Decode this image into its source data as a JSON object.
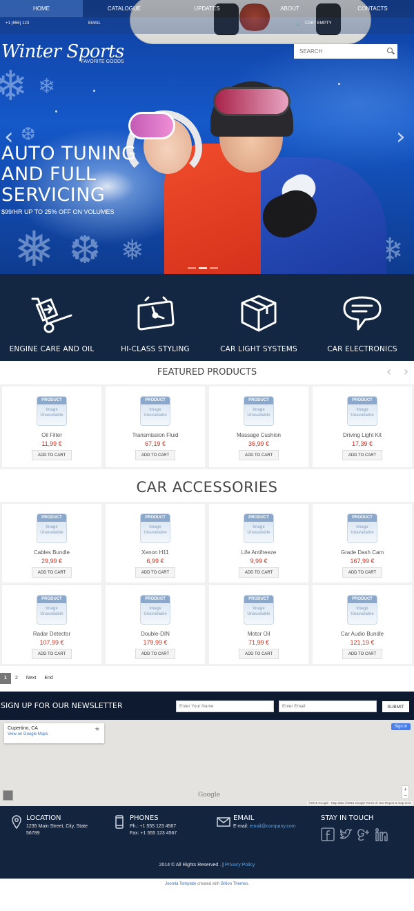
{
  "nav": {
    "items": [
      {
        "label": "HOME",
        "active": true
      },
      {
        "label": "CATALOGUE",
        "active": false
      },
      {
        "label": "UPDATES",
        "active": false
      },
      {
        "label": "ABOUT",
        "active": false
      },
      {
        "label": "CONTACTS",
        "active": false
      }
    ]
  },
  "infobar": {
    "phone": "+1 (555) 123",
    "email": "EMAIL",
    "cart": "CART EMPTY"
  },
  "brand": {
    "name": "Winter Sports",
    "tagline": "FAVORITE GOODS"
  },
  "search": {
    "placeholder": "SEARCH"
  },
  "hero": {
    "title_line1": "AUTO TUNING",
    "title_line2": "AND FULL",
    "title_line3": "SERVICING",
    "subtitle": "$99/HR UP TO 25% OFF ON VOLUMES",
    "prev": "‹",
    "next": "›"
  },
  "features": [
    {
      "label": "ENGINE CARE AND OIL",
      "icon": "hand-truck-icon"
    },
    {
      "label": "HI-CLASS STYLING",
      "icon": "clock-ticket-icon"
    },
    {
      "label": "CAR LIGHT SYSTEMS",
      "icon": "box-icon"
    },
    {
      "label": "CAR ELECTRONICS",
      "icon": "chat-bubble-icon"
    }
  ],
  "placeholder": {
    "bar": "PRODUCT",
    "line1": "Image",
    "line2": "Unavailable"
  },
  "featured": {
    "title": "FEATURED PRODUCTS",
    "prev": "‹",
    "next": "›",
    "products": [
      {
        "name": "Oil Filter",
        "price": "11,99 €",
        "button": "ADD TO CART"
      },
      {
        "name": "Transmission Fluid",
        "price": "67,19 €",
        "button": "ADD TO CART"
      },
      {
        "name": "Massage Cushion",
        "price": "36,99 €",
        "button": "ADD TO CART"
      },
      {
        "name": "Driving Light Kit",
        "price": "17,39 €",
        "button": "ADD TO CART"
      }
    ]
  },
  "accessories": {
    "title": "CAR ACCESSORIES",
    "rows": [
      [
        {
          "name": "Cables Bundle",
          "price": "29,99 €",
          "button": "ADD TO CART"
        },
        {
          "name": "Xenon H11",
          "price": "6,99 €",
          "button": "ADD TO CART"
        },
        {
          "name": "Life Antifreeze",
          "price": "9,99 €",
          "button": "ADD TO CART"
        },
        {
          "name": "Grade Dash Cam",
          "price": "167,99 €",
          "button": "ADD TO CART"
        }
      ],
      [
        {
          "name": "Radar Detector",
          "price": "107,99 €",
          "button": "ADD TO CART"
        },
        {
          "name": "Double-DIN",
          "price": "179,99 €",
          "button": "ADD TO CART"
        },
        {
          "name": "Motor Oil",
          "price": "71,99 €",
          "button": "ADD TO CART"
        },
        {
          "name": "Car Audio Bundle",
          "price": "121,19 €",
          "button": "ADD TO CART"
        }
      ]
    ]
  },
  "pager": {
    "current": "1",
    "page2": "2",
    "next": "Next",
    "end": "End"
  },
  "newsletter": {
    "title": "SIGN UP FOR OUR NEWSLETTER",
    "name_placeholder": "Enter Your Name",
    "email_placeholder": "Enter Email",
    "submit": "SUBMIT"
  },
  "map": {
    "place": "Cupertino, CA",
    "link": "View on Google Maps",
    "signin": "Sign in",
    "logo": "Google",
    "credits": "©2015 Google - Map data ©2015 Google   Terms of Use   Report a map error"
  },
  "footer": {
    "location": {
      "title": "LOCATION",
      "line1": "1235 Main Street, City, State",
      "line2": "56789"
    },
    "phones": {
      "title": "PHONES",
      "line1": "Ph.: +1 555 123 4567",
      "line2": "Fax: +1 555 123 4567"
    },
    "email": {
      "title": "EMAIL",
      "prefix": "E-mail: ",
      "address": "email@company.com"
    },
    "social": {
      "title": "STAY IN TOUCH"
    },
    "copyright": "2014 © All Rights Reserved . | ",
    "privacy": "Privacy Policy"
  },
  "credit": {
    "link1": "Joomla Template",
    "middle": " created with ",
    "link2": "Billion Themes",
    "end": "."
  },
  "colors": {
    "nav_bg": "#132642",
    "price": "#d3301f",
    "link": "#5aa0e0"
  }
}
